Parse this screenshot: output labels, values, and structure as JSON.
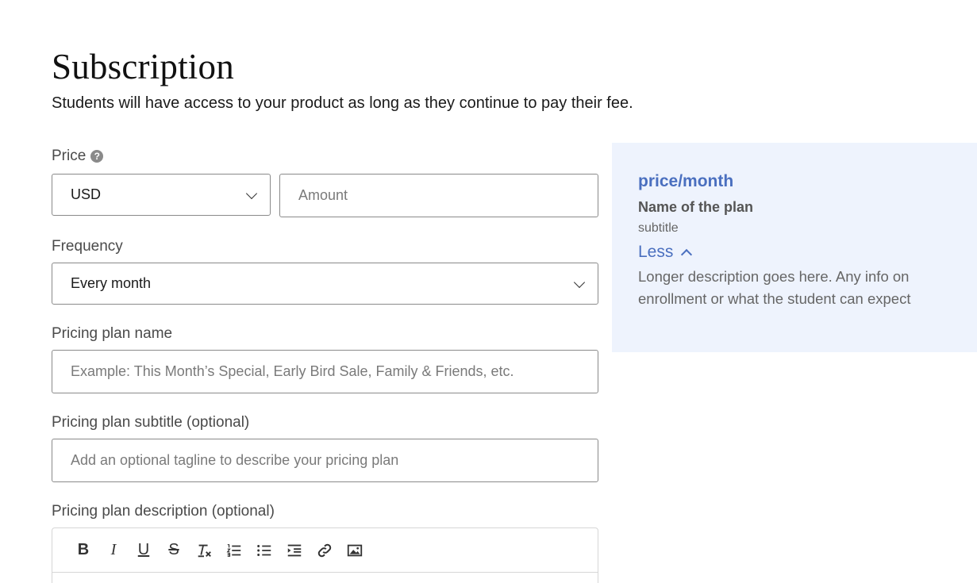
{
  "header": {
    "title": "Subscription",
    "subtitle": "Students will have access to your product as long as they continue to pay their fee."
  },
  "form": {
    "price_label": "Price",
    "currency_value": "USD",
    "amount_placeholder": "Amount",
    "frequency_label": "Frequency",
    "frequency_value": "Every month",
    "plan_name_label": "Pricing plan name",
    "plan_name_placeholder": "Example: This Month’s Special, Early Bird Sale, Family & Friends, etc.",
    "plan_subtitle_label": "Pricing plan subtitle (optional)",
    "plan_subtitle_placeholder": "Add an optional tagline to describe your pricing plan",
    "plan_description_label": "Pricing plan description (optional)"
  },
  "toolbar": {
    "bold": "B",
    "italic": "I",
    "underline": "U",
    "strike": "S",
    "icons": [
      "bold-icon",
      "italic-icon",
      "underline-icon",
      "strikethrough-icon",
      "clear-format-icon",
      "ordered-list-icon",
      "bullet-list-icon",
      "indent-icon",
      "link-icon",
      "image-icon"
    ]
  },
  "preview": {
    "price": "price/month",
    "name": "Name of the plan",
    "subtitle": "subtitle",
    "less_label": "Less",
    "description": "Longer description goes here. Any info on enrollment or what the student can expect"
  },
  "colors": {
    "accent": "#4a6fbf",
    "preview_bg": "#eef3fd",
    "border": "#8a8a8a"
  }
}
